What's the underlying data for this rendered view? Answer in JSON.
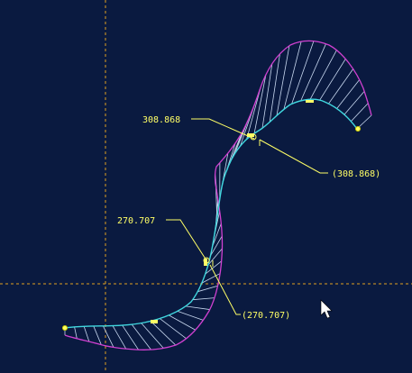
{
  "colors": {
    "background": "#0a1a40",
    "curve": "#40d8e0",
    "comb_envelope": "#d040d0",
    "comb_teeth": "#c8d8f0",
    "annotation": "#ffff66",
    "datum_axis": "#e0a020",
    "cursor": "#ffffff"
  },
  "annotations": [
    {
      "id": "upper-dimension",
      "label": "308.868",
      "parenthesized_label": "(308.868)"
    },
    {
      "id": "lower-dimension",
      "label": "270.707",
      "parenthesized_label": "(270.707)"
    }
  ],
  "icons": {
    "cursor": "mouse-pointer-arrow-icon"
  }
}
